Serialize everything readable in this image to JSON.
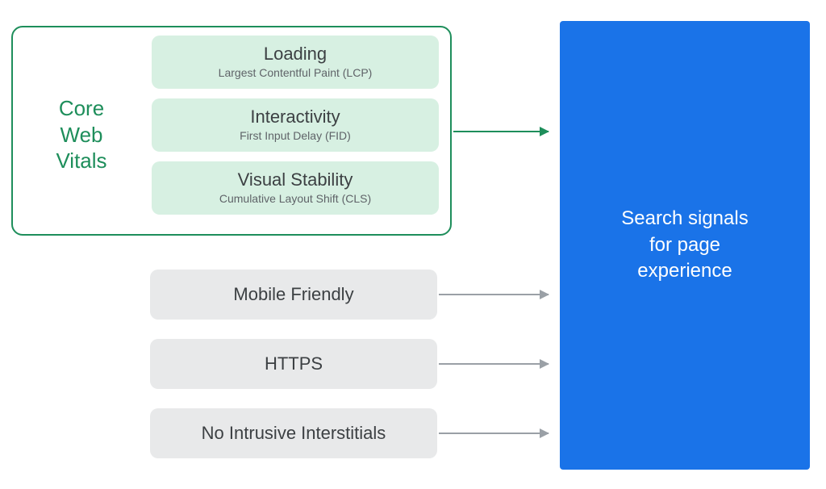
{
  "core_web_vitals": {
    "label_line1": "Core",
    "label_line2": "Web",
    "label_line3": "Vitals",
    "items": [
      {
        "title": "Loading",
        "sub": "Largest Contentful Paint (LCP)"
      },
      {
        "title": "Interactivity",
        "sub": "First Input Delay (FID)"
      },
      {
        "title": "Visual Stability",
        "sub": "Cumulative Layout Shift (CLS)"
      }
    ]
  },
  "other_signals": [
    "Mobile Friendly",
    "HTTPS",
    "No Intrusive Interstitials"
  ],
  "result": {
    "line1": "Search signals",
    "line2": "for page",
    "line3": "experience"
  },
  "colors": {
    "green": "#1e8e5b",
    "mint": "#d7f0e2",
    "grey": "#e8e9ea",
    "arrow_grey": "#9aa0a6",
    "blue": "#1a73e8",
    "text": "#3c4043"
  }
}
